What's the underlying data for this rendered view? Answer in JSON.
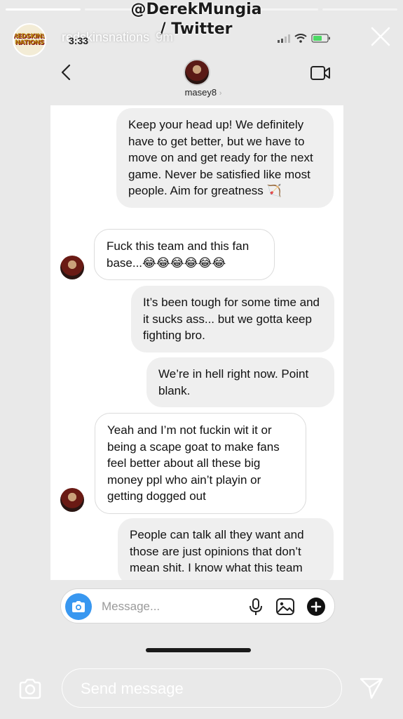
{
  "story": {
    "watermark": "@DerekMungia\n/ Twitter",
    "username": "redskinsnations",
    "time_ago": "9m",
    "avatar_text": "REDSKINS\nNATIONS"
  },
  "phone": {
    "time": "3:33"
  },
  "dm": {
    "username": "masey8",
    "chevron": "›"
  },
  "messages": [
    {
      "from": "me",
      "text": "Keep your head up! We definitely have to get better, but we have to move on and get ready for the next game. Never be satisfied like most people. Aim for greatness 🏹"
    },
    {
      "from": "them",
      "text": "Fuck this team and this fan base...😂😂😂😂😂😂"
    },
    {
      "from": "me",
      "text": "It’s been tough for some time and it sucks ass... but we gotta keep fighting bro."
    },
    {
      "from": "me",
      "text": "We’re in hell right now. Point blank."
    },
    {
      "from": "them",
      "text": "Yeah and I’m not fuckin wit it or being a scape goat to make fans feel better about all these big money ppl who ain’t playin or getting dogged out"
    },
    {
      "from": "me",
      "text": "People can talk all they want and those are just opinions that don’t mean shit. I know what this team"
    }
  ],
  "composer": {
    "placeholder": "Message..."
  },
  "reply": {
    "placeholder": "Send message"
  },
  "colors": {
    "accent": "#3897f0",
    "outgoing_bubble": "#efefef",
    "background": "#e9e9e9"
  }
}
